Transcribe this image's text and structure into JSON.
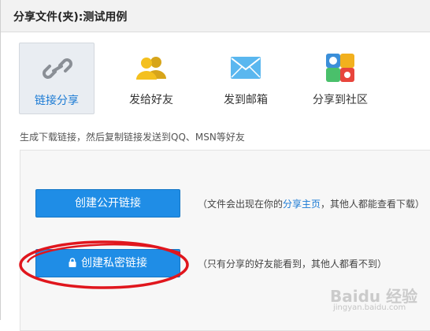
{
  "dialog": {
    "title": "分享文件(夹):测试用例"
  },
  "tabs": [
    {
      "label": "链接分享",
      "icon": "link-icon",
      "active": true
    },
    {
      "label": "发给好友",
      "icon": "friends-icon",
      "active": false
    },
    {
      "label": "发到邮箱",
      "icon": "envelope-icon",
      "active": false
    },
    {
      "label": "分享到社区",
      "icon": "community-icon",
      "active": false
    }
  ],
  "hint": "生成下载链接，然后复制链接发送到QQ、MSN等好友",
  "public_link": {
    "button_label": "创建公开链接",
    "note_prefix": "（文件会出现在你的",
    "note_link": "分享主页",
    "note_suffix": "，其他人都能查看下载）"
  },
  "private_link": {
    "button_label": "创建私密链接",
    "icon": "lock-icon",
    "note": "（只有分享的好友能看到，其他人都看不到）"
  },
  "watermark": {
    "text": "Baidu 经验",
    "sub": "jingyan.baidu.com"
  },
  "colors": {
    "accent": "#1f8de6",
    "link": "#1a7ad4",
    "highlight_ring": "#e0161d"
  }
}
